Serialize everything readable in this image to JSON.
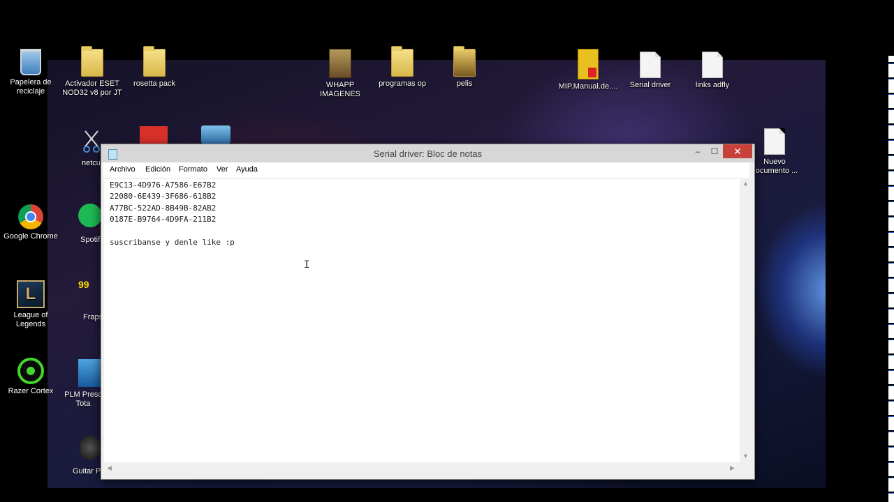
{
  "desktop": {
    "icons": [
      {
        "label": "Papelera de reciclaje",
        "icon": "recycle-bin-icon"
      },
      {
        "label": "Activador ESET NOD32 v8 por JT",
        "icon": "folder-icon"
      },
      {
        "label": "rosetta pack",
        "icon": "folder-icon"
      },
      {
        "label": "WHAPP IMAGENES",
        "icon": "folder-icon"
      },
      {
        "label": "programas op",
        "icon": "folder-icon"
      },
      {
        "label": "pelis",
        "icon": "folder-icon"
      },
      {
        "label": "MIP.Manual.de....",
        "icon": "book-icon"
      },
      {
        "label": "Serial driver",
        "icon": "text-file-icon"
      },
      {
        "label": "links adfly",
        "icon": "text-file-icon"
      },
      {
        "label": "Nuevo documento ...",
        "icon": "text-file-icon"
      },
      {
        "label": "Google Chrome",
        "icon": "chrome-icon"
      },
      {
        "label": "League of Legends",
        "icon": "league-icon"
      },
      {
        "label": "Razer Cortex",
        "icon": "razer-icon"
      },
      {
        "label": "netcu",
        "icon": "netcut-icon"
      },
      {
        "label": "Spotif",
        "icon": "spotify-icon"
      },
      {
        "label": "Fraps",
        "icon": "fraps-icon"
      },
      {
        "label": "PLM Presc Tota",
        "icon": "plm-icon"
      },
      {
        "label": "Guitar P",
        "icon": "guitar-icon"
      }
    ]
  },
  "notepad": {
    "title": "Serial driver: Bloc de notas",
    "menu": [
      "Archivo",
      "Edición",
      "Formato",
      "Ver",
      "Ayuda"
    ],
    "lines": [
      "E9C13-4D976-A7586-E67B2",
      "22080-6E439-3F686-618B2",
      "A77BC-522AD-8B49B-82AB2",
      "0187E-B9764-4D9FA-211B2",
      "",
      "suscribanse y denle like :p"
    ],
    "caret_glyph": "I",
    "minimize_glyph": "–",
    "maximize_glyph": "☐",
    "close_glyph": "✕"
  },
  "colors": {
    "close_button": "#c7413b",
    "titlebar": "#d7d7d7"
  }
}
